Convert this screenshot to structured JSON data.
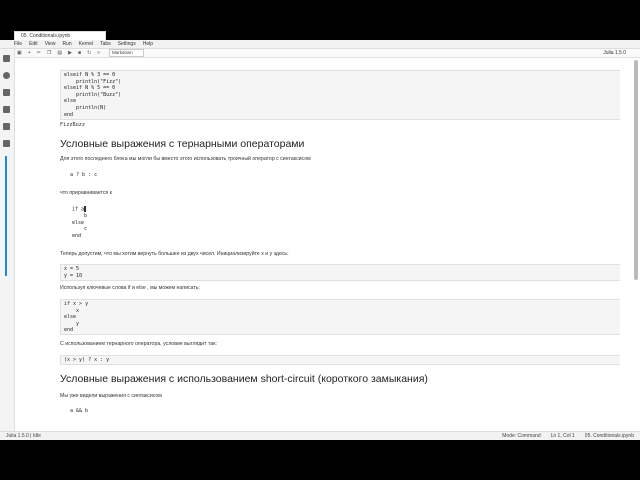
{
  "menu": [
    "File",
    "Edit",
    "View",
    "Run",
    "Kernel",
    "Tabs",
    "Settings",
    "Help"
  ],
  "tab": {
    "label": "05. Conditionals.ipynb"
  },
  "toolbar": {
    "cell_type": "Markdown",
    "kernel": "Julia 1.5.0"
  },
  "cells": {
    "code1": [
      "elseif N % 3 == 0",
      "    println(\"Fizz\")",
      "elseif N % 5 == 0",
      "    println(\"Buzz\")",
      "else",
      "    println(N)",
      "end"
    ],
    "output1": "FizzBuzz",
    "heading1": "Условные выражения с тернарными операторами",
    "p1": "Для этого последнего блока мы могли бы вместо этого использовать троичный оператор с синтаксисом",
    "ternary": "a ? b : c",
    "p2": "что приравнивается к",
    "ifblock": [
      "if a",
      "    b",
      "else",
      "    c",
      "end"
    ],
    "p3": "Теперь допустим, что мы хотим вернуть большее из двух чисел. Инициализируйте  x  и  y  здесь:",
    "code2": [
      "x = 5",
      "y = 10"
    ],
    "p4": "Используя ключевые слова  if  и  else , мы можем написать:",
    "code3": [
      "if x > y",
      "    x",
      "else",
      "    y",
      "end"
    ],
    "p5": "С использованием тернарного оператора, условие выглядит так:",
    "code4": "(x > y) ? x : y",
    "heading2": "Условные выражения с использованием short-circuit (короткого замыкания)",
    "p6": "Мы уже видели выражения с синтаксисом",
    "shortc": "a && b"
  },
  "status": {
    "left": "Julia 1.5.0 | Idle",
    "mode": "Mode: Command",
    "pos": "Ln 1, Col 1",
    "file": "05. Conditionals.ipynb"
  }
}
